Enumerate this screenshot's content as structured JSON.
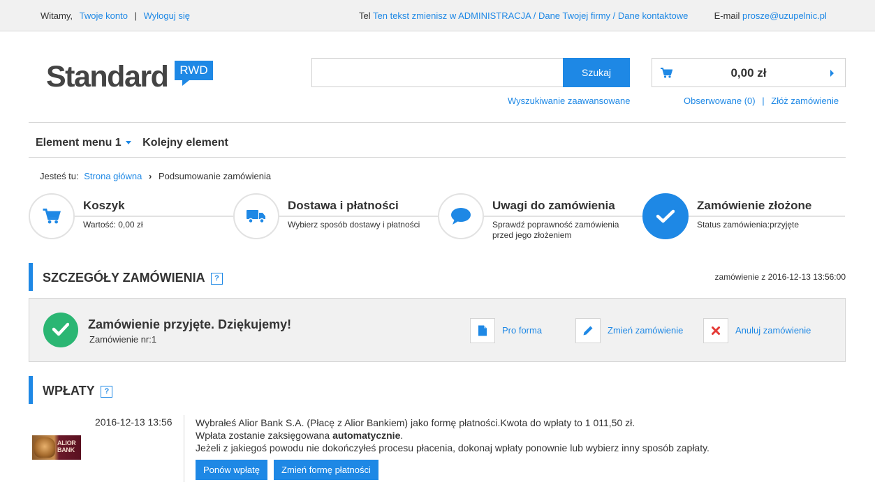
{
  "topbar": {
    "welcome": "Witamy,",
    "account_link": "Twoje konto",
    "separator": "|",
    "logout_link": "Wyloguj się",
    "tel_label": "Tel",
    "tel_value": "Ten tekst zmienisz w ADMINISTRACJA / Dane Twojej firmy / Dane kontaktowe",
    "email_label": "E-mail",
    "email_value": "prosze@uzupelnic.pl"
  },
  "header": {
    "logo_text": "Standard",
    "logo_badge": "RWD",
    "search_placeholder": "",
    "search_button": "Szukaj",
    "advanced_search": "Wyszukiwanie zaawansowane",
    "cart_amount": "0,00 zł",
    "observed_link": "Obserwowane (0)",
    "links_separator": "|",
    "place_order_link": "Złóż zamówienie"
  },
  "nav": {
    "items": [
      {
        "label": "Element menu 1",
        "has_dropdown": true
      },
      {
        "label": "Kolejny element",
        "has_dropdown": false
      }
    ]
  },
  "breadcrumb": {
    "label": "Jesteś tu:",
    "home": "Strona główna",
    "current": "Podsumowanie zamówienia"
  },
  "steps": [
    {
      "title": "Koszyk",
      "desc": "Wartość: 0,00 zł",
      "icon": "cart-icon",
      "active": false
    },
    {
      "title": "Dostawa i płatności",
      "desc": "Wybierz sposób dostawy i płatności",
      "icon": "truck-icon",
      "active": false
    },
    {
      "title": "Uwagi do zamówienia",
      "desc": "Sprawdź poprawność zamówienia przed jego złożeniem",
      "icon": "speech-bubble-icon",
      "active": false
    },
    {
      "title": "Zamówienie złożone",
      "desc": "Status zamówienia:przyjęte",
      "icon": "check-icon",
      "active": true
    }
  ],
  "order_details": {
    "heading": "SZCZEGÓŁY ZAMÓWIENIA",
    "help": "?",
    "date": "zamówienie z 2016-12-13 13:56:00",
    "confirm_title": "Zamówienie przyjęte. Dziękujemy!",
    "confirm_sub": "Zamówienie nr:1",
    "actions": [
      {
        "label": "Pro forma",
        "icon": "document-icon"
      },
      {
        "label": "Zmień zamówienie",
        "icon": "pencil-icon"
      },
      {
        "label": "Anuluj zamówienie",
        "icon": "close-icon"
      }
    ]
  },
  "payments": {
    "heading": "WPŁATY",
    "help": "?",
    "logo_line1": "ALIOR",
    "logo_line2": "BANK",
    "date": "2016-12-13 13:56",
    "line1": "Wybrałeś Alior Bank S.A. (Płacę z Alior Bankiem) jako formę płatności.Kwota do wpłaty to 1 011,50 zł.",
    "line2_prefix": "Wpłata zostanie zaksięgowana ",
    "line2_bold": "automatycznie",
    "line2_suffix": ".",
    "line3": "Jeżeli z jakiegoś powodu nie dokończyłeś procesu płacenia, dokonaj wpłaty ponownie lub wybierz inny sposób zapłaty.",
    "retry_button": "Ponów wpłatę",
    "change_button": "Zmień formę płatności"
  },
  "colors": {
    "accent": "#1e88e5",
    "success": "#2bb673",
    "danger": "#e53935"
  }
}
